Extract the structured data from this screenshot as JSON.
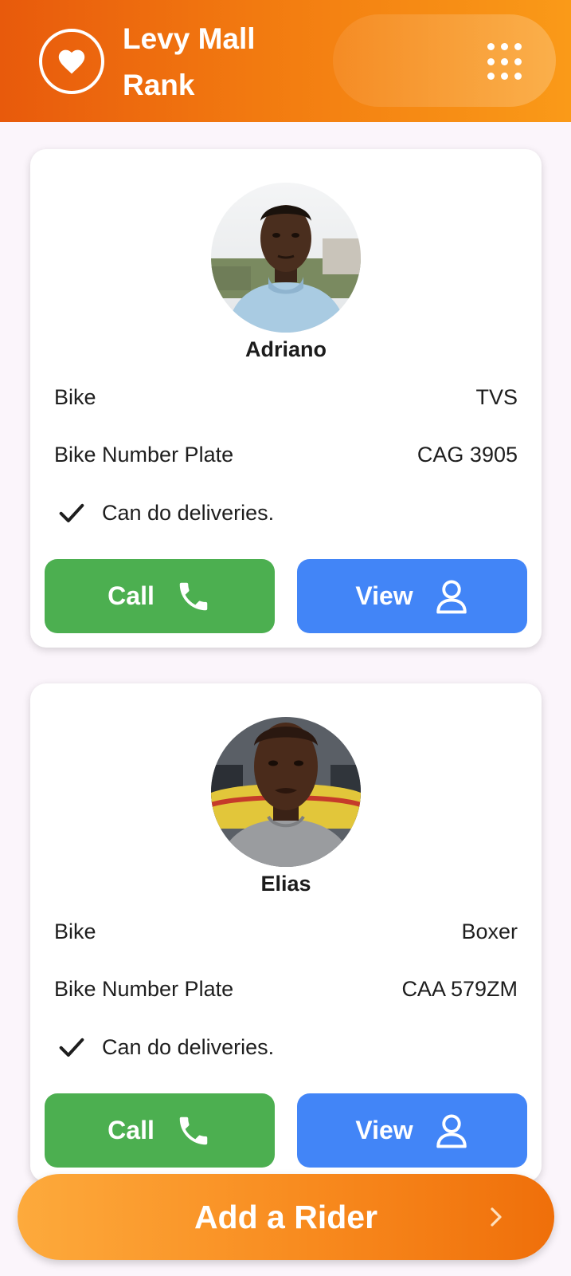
{
  "header": {
    "title": "Levy Mall Rank",
    "logo_icon": "heart-icon",
    "menu_icon": "grid-menu-icon"
  },
  "riders": [
    {
      "name": "Adriano",
      "bike_label": "Bike",
      "bike_value": "TVS",
      "plate_label": "Bike Number Plate",
      "plate_value": "CAG 3905",
      "delivery_text": "Can do deliveries.",
      "call_label": "Call",
      "view_label": "View"
    },
    {
      "name": "Elias",
      "bike_label": "Bike",
      "bike_value": "Boxer",
      "plate_label": "Bike Number Plate",
      "plate_value": "CAA 579ZM",
      "delivery_text": "Can do deliveries.",
      "call_label": "Call",
      "view_label": "View"
    }
  ],
  "footer": {
    "add_rider_label": "Add a Rider"
  },
  "colors": {
    "header_start": "#e85a0c",
    "header_end": "#fa9a18",
    "call_green": "#4caf50",
    "view_blue": "#4285f7",
    "add_button": "#f88a1e"
  }
}
